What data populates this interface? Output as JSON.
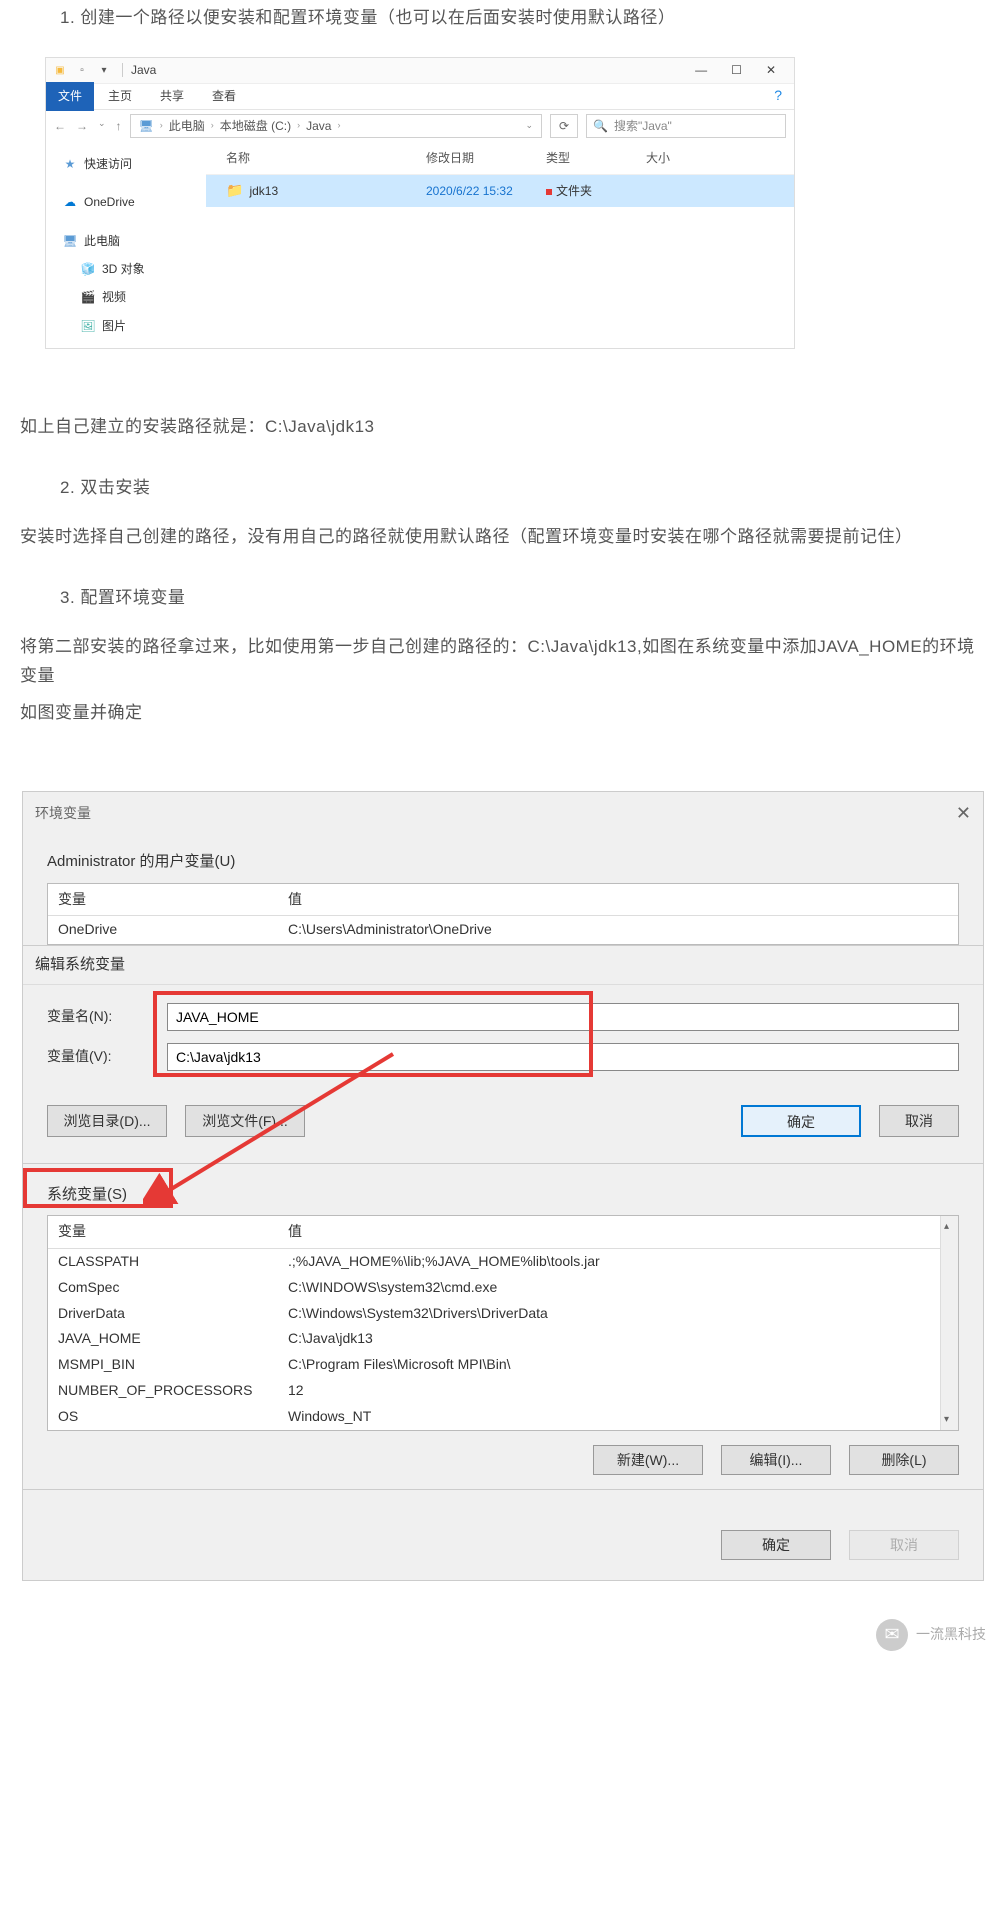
{
  "text": {
    "step1": "1. 创建一个路径以便安装和配置环境变量（也可以在后面安装时使用默认路径）",
    "path_result": "如上自己建立的安装路径就是：C:\\Java\\jdk13",
    "step2": "2. 双击安装",
    "step2_desc": "安装时选择自己创建的路径，没有用自己的路径就使用默认路径（配置环境变量时安装在哪个路径就需要提前记住）",
    "step3": "3. 配置环境变量",
    "step3_desc1": "将第二部安装的路径拿过来，比如使用第一步自己创建的路径的：C:\\Java\\jdk13,如图在系统变量中添加JAVA_HOME的环境变量",
    "step3_desc2": "如图变量并确定"
  },
  "explorer": {
    "title": "Java",
    "tabs": {
      "file": "文件",
      "home": "主页",
      "share": "共享",
      "view": "查看"
    },
    "breadcrumb": [
      "此电脑",
      "本地磁盘 (C:)",
      "Java"
    ],
    "search_placeholder": "搜索\"Java\"",
    "columns": {
      "name": "名称",
      "date": "修改日期",
      "type": "类型",
      "size": "大小"
    },
    "folder": {
      "name": "jdk13",
      "date": "2020/6/22 15:32",
      "type": "文件夹"
    },
    "sidebar": {
      "quick": "快速访问",
      "onedrive": "OneDrive",
      "pc": "此电脑",
      "threed": "3D 对象",
      "video": "视频",
      "pictures": "图片"
    }
  },
  "env": {
    "title": "环境变量",
    "user_vars_label": "Administrator 的用户变量(U)",
    "col_var": "变量",
    "col_val": "值",
    "user_rows": [
      {
        "var": "OneDrive",
        "val": "C:\\Users\\Administrator\\OneDrive"
      }
    ],
    "edit_title": "编辑系统变量",
    "name_label": "变量名(N):",
    "value_label": "变量值(V):",
    "name_value": "JAVA_HOME",
    "value_value": "C:\\Java\\jdk13",
    "browse_dir": "浏览目录(D)...",
    "browse_file": "浏览文件(F)...",
    "ok": "确定",
    "cancel": "取消",
    "sys_vars_label": "系统变量(S)",
    "sys_rows": [
      {
        "var": "CLASSPATH",
        "val": ".;%JAVA_HOME%\\lib;%JAVA_HOME%lib\\tools.jar"
      },
      {
        "var": "ComSpec",
        "val": "C:\\WINDOWS\\system32\\cmd.exe"
      },
      {
        "var": "DriverData",
        "val": "C:\\Windows\\System32\\Drivers\\DriverData"
      },
      {
        "var": "JAVA_HOME",
        "val": "C:\\Java\\jdk13"
      },
      {
        "var": "MSMPI_BIN",
        "val": "C:\\Program Files\\Microsoft MPI\\Bin\\"
      },
      {
        "var": "NUMBER_OF_PROCESSORS",
        "val": "12"
      },
      {
        "var": "OS",
        "val": "Windows_NT"
      }
    ],
    "new_btn": "新建(W)...",
    "edit_btn": "编辑(I)...",
    "delete_btn": "删除(L)"
  },
  "overlay": {
    "brand": "一流黑科技"
  }
}
